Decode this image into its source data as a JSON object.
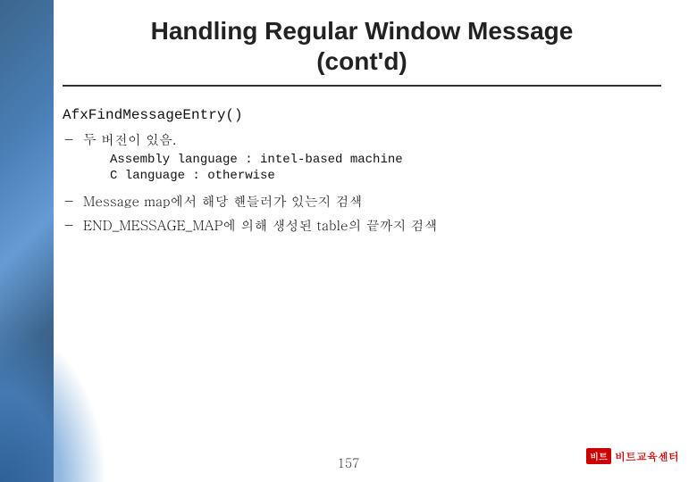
{
  "slide": {
    "title_line1": "Handling Regular Window Message",
    "title_line2": "(cont'd)",
    "function_name": "AfxFindMessageEntry()",
    "bullets": [
      {
        "text": "두 버전이 있음.",
        "sub_items": [
          "Assembly language : intel-based machine",
          "C language : otherwise"
        ]
      },
      {
        "text": "Message map에서 해당 핸들러가 있는지 검색",
        "sub_items": []
      },
      {
        "text": "END_MESSAGE_MAP에 의해 생성된 table의 끝까지 검색",
        "sub_items": []
      }
    ],
    "page_number": "157",
    "logo_box_text": "비트",
    "logo_text": "비트교육센터"
  }
}
